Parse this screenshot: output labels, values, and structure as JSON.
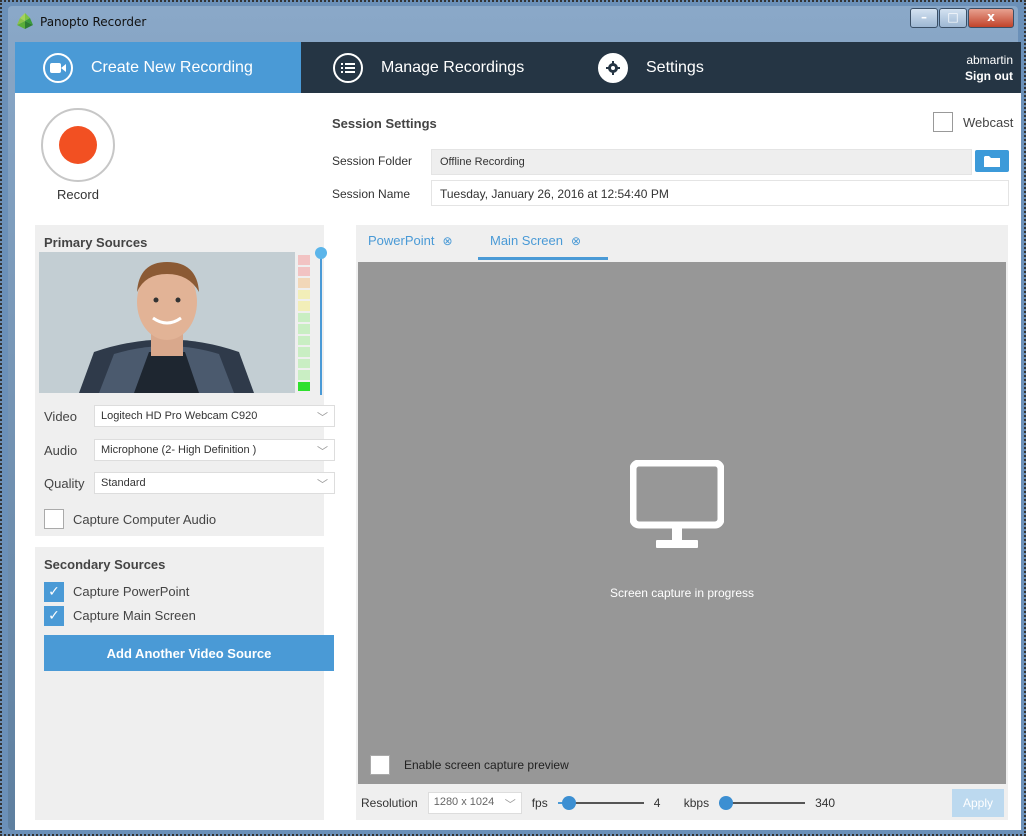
{
  "window": {
    "title": "Panopto Recorder"
  },
  "nav": {
    "tabs": [
      {
        "label": "Create New Recording",
        "icon": "video-camera-icon",
        "active": true
      },
      {
        "label": "Manage Recordings",
        "icon": "list-icon",
        "active": false
      },
      {
        "label": "Settings",
        "icon": "gear-icon",
        "active": false
      }
    ],
    "user": {
      "name": "abmartin",
      "signout": "Sign out"
    }
  },
  "record": {
    "label": "Record"
  },
  "session": {
    "title": "Session Settings",
    "webcast_label": "Webcast",
    "webcast_checked": false,
    "folder_label": "Session Folder",
    "folder_value": "Offline Recording",
    "name_label": "Session Name",
    "name_value": "Tuesday, January 26, 2016 at 12:54:40 PM"
  },
  "primary": {
    "title": "Primary Sources",
    "video_label": "Video",
    "video_value": "Logitech HD Pro Webcam C920",
    "audio_label": "Audio",
    "audio_value": "Microphone (2- High Definition )",
    "quality_label": "Quality",
    "quality_value": "Standard",
    "capture_audio_label": "Capture Computer Audio",
    "capture_audio_checked": false,
    "audio_level": 0.1
  },
  "secondary": {
    "title": "Secondary Sources",
    "capture_ppt_label": "Capture PowerPoint",
    "capture_ppt_checked": true,
    "capture_screen_label": "Capture Main Screen",
    "capture_screen_checked": true,
    "add_button": "Add Another Video Source"
  },
  "preview": {
    "tabs": [
      {
        "label": "PowerPoint",
        "active": false
      },
      {
        "label": "Main Screen",
        "active": true
      }
    ],
    "message": "Screen capture in progress",
    "enable_preview_label": "Enable screen capture preview",
    "resolution_label": "Resolution",
    "resolution_value": "1280 x 1024",
    "fps_label": "fps",
    "fps_value": "4",
    "kbps_label": "kbps",
    "kbps_value": "340",
    "apply_label": "Apply"
  },
  "colors": {
    "accent": "#4a9ad6",
    "nav_bg": "#253544",
    "record_red": "#f25022"
  }
}
